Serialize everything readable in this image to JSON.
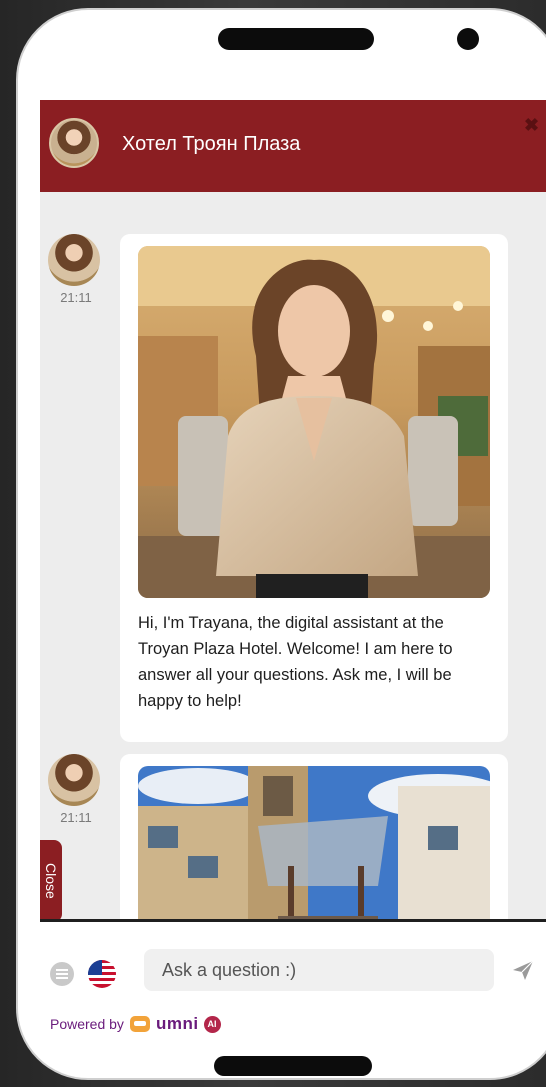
{
  "header": {
    "title": "Хотел Троян Плаза",
    "close_icon": "close-icon"
  },
  "messages": [
    {
      "time": "21:11",
      "text": "Hi, I'm Trayana, the digital assistant at the Troyan Plaza Hotel. Welcome! I am here to answer all your questions. Ask me, I will be happy to help!"
    },
    {
      "time": "21:11",
      "text": ""
    }
  ],
  "side_tab": {
    "label": "Close"
  },
  "composer": {
    "placeholder": "Ask a question :)",
    "menu_icon": "menu-icon",
    "language_flag": "us-flag-icon",
    "send_icon": "send-icon"
  },
  "footer": {
    "powered_by": "Powered by",
    "brand": "umni"
  },
  "colors": {
    "header_bg": "#8b1e22",
    "chat_bg": "#ededed",
    "brand_purple": "#6a1b7c"
  }
}
